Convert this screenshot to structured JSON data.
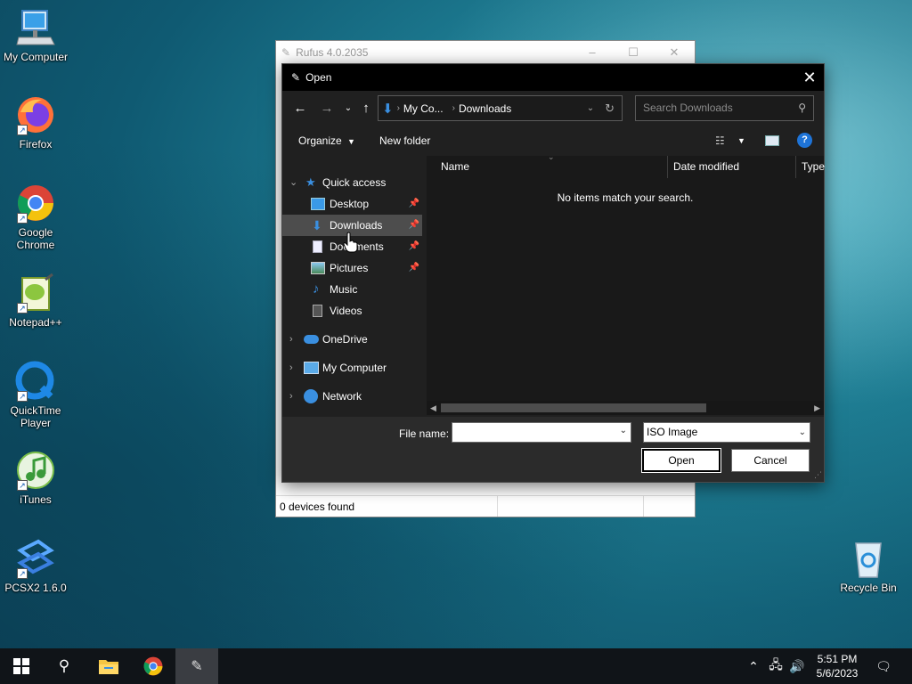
{
  "desktop": {
    "icons": [
      {
        "label": "My Computer"
      },
      {
        "label": "Firefox"
      },
      {
        "label": "Google Chrome"
      },
      {
        "label": "Notepad++"
      },
      {
        "label": "QuickTime Player"
      },
      {
        "label": "iTunes"
      },
      {
        "label": "PCSX2 1.6.0"
      },
      {
        "label": "Recycle Bin"
      }
    ]
  },
  "rufus": {
    "title": "Rufus 4.0.2035",
    "status": "0 devices found"
  },
  "dialog": {
    "title": "Open",
    "address": {
      "crumb1": "My Co...",
      "crumb2": "Downloads"
    },
    "search_placeholder": "Search Downloads",
    "toolbar": {
      "organize": "Organize",
      "new_folder": "New folder"
    },
    "nav": {
      "quick_access": "Quick access",
      "items": [
        {
          "label": "Desktop"
        },
        {
          "label": "Downloads"
        },
        {
          "label": "Documents"
        },
        {
          "label": "Pictures"
        },
        {
          "label": "Music"
        },
        {
          "label": "Videos"
        }
      ],
      "onedrive": "OneDrive",
      "my_computer": "My Computer",
      "network": "Network"
    },
    "columns": {
      "name": "Name",
      "date_modified": "Date modified",
      "type": "Type"
    },
    "empty_message": "No items match your search.",
    "file_name_label": "File name:",
    "file_name_value": "",
    "file_type": "ISO Image",
    "open_label": "Open",
    "cancel_label": "Cancel"
  },
  "taskbar": {
    "time": "5:51 PM",
    "date": "5/6/2023"
  },
  "colors": {
    "dialog_bg": "#202020",
    "accent_blue": "#3a8fe0"
  }
}
